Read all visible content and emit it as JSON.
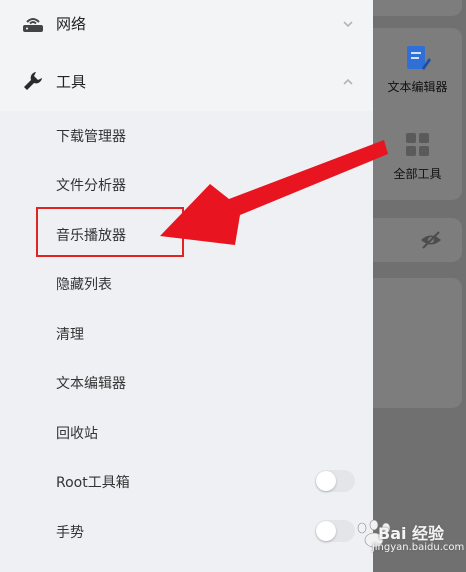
{
  "menu": {
    "network_label": "网络",
    "tools_label": "工具"
  },
  "submenu": {
    "items": [
      {
        "label": "下载管理器"
      },
      {
        "label": "文件分析器"
      },
      {
        "label": "音乐播放器"
      },
      {
        "label": "隐藏列表"
      },
      {
        "label": "清理"
      },
      {
        "label": "文本编辑器"
      },
      {
        "label": "回收站"
      },
      {
        "label": "Root工具箱"
      },
      {
        "label": "手势"
      }
    ]
  },
  "right_panel": {
    "app_editor_label": "文本编辑器",
    "app_tools_label": "全部工具"
  },
  "watermark": {
    "brand": "Bai 经验",
    "url": "jingyan.baidu.com"
  },
  "colors": {
    "highlight": "#e02323",
    "arrow": "#e8141f",
    "editor_icon": "#2f6fd6"
  }
}
